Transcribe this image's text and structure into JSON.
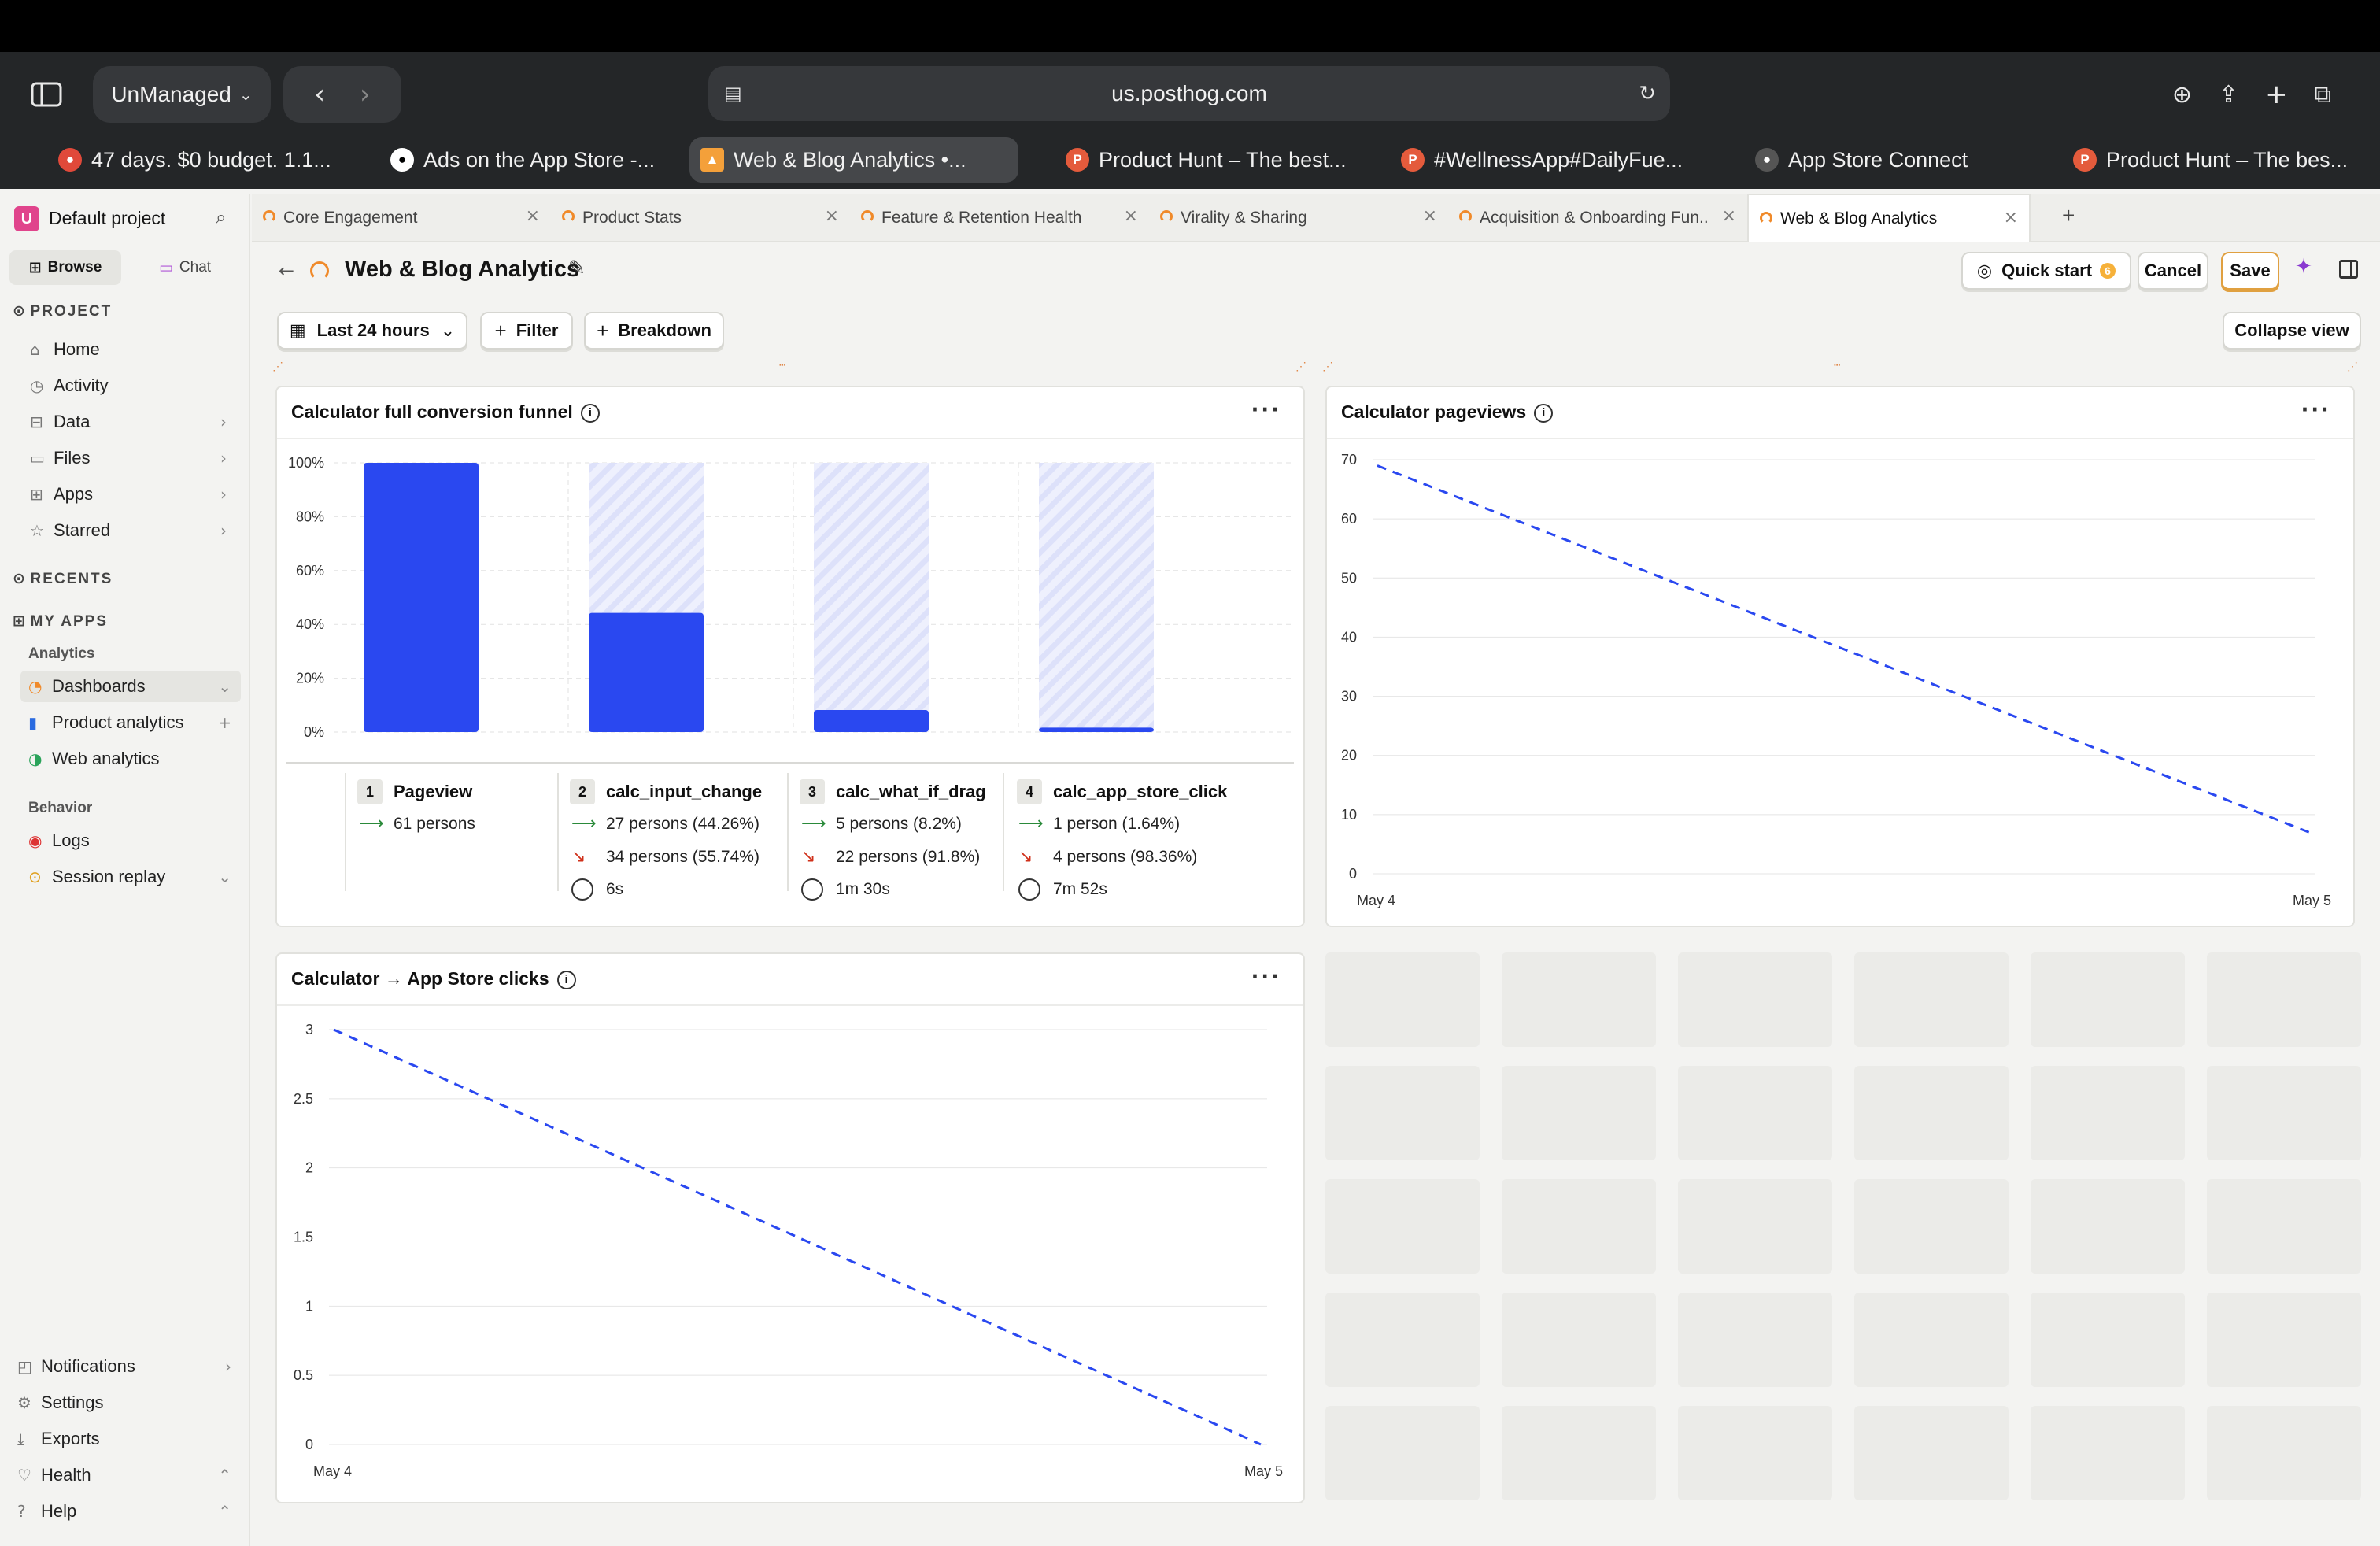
{
  "browser": {
    "profile": "UnManaged",
    "url": "us.posthog.com",
    "tabs": [
      {
        "title": "47 days. $0 budget. 1.1...",
        "color": "#e0493a",
        "icon": "reddit-icon"
      },
      {
        "title": "Ads on the App Store -...",
        "color": "#ffffff",
        "icon": "apple-icon"
      },
      {
        "title": "Web & Blog Analytics •...",
        "color": "#f4a03a",
        "icon": "posthog-icon"
      },
      {
        "title": "Product Hunt – The best...",
        "color": "#e45b3c",
        "icon": "producthunt-icon"
      },
      {
        "title": "#WellnessApp#DailyFue...",
        "color": "#e45b3c",
        "icon": "producthunt-icon"
      },
      {
        "title": "App Store Connect",
        "color": "#555",
        "icon": "apple-icon"
      },
      {
        "title": "Product Hunt – The bes...",
        "color": "#e45b3c",
        "icon": "producthunt-icon"
      }
    ]
  },
  "sidebar": {
    "project_badge": "U",
    "project": "Default project",
    "browse": "Browse",
    "chat": "Chat",
    "project_heading": "PROJECT",
    "nav": [
      {
        "label": "Home",
        "icon": "home-icon"
      },
      {
        "label": "Activity",
        "icon": "clock-icon"
      },
      {
        "label": "Data",
        "icon": "database-icon"
      },
      {
        "label": "Files",
        "icon": "folder-icon"
      },
      {
        "label": "Apps",
        "icon": "apps-icon"
      },
      {
        "label": "Starred",
        "icon": "star-icon"
      }
    ],
    "recents_heading": "RECENTS",
    "myapps_heading": "MY APPS",
    "analytics_heading": "Analytics",
    "analytics": [
      {
        "label": "Dashboards",
        "icon": "dashboard-icon"
      },
      {
        "label": "Product analytics",
        "icon": "bar-chart-icon"
      },
      {
        "label": "Web analytics",
        "icon": "web-icon"
      }
    ],
    "behavior_heading": "Behavior",
    "behavior": [
      {
        "label": "Logs",
        "icon": "logs-icon"
      },
      {
        "label": "Session replay",
        "icon": "replay-icon"
      }
    ],
    "footer": [
      {
        "label": "Notifications",
        "icon": "bell-icon"
      },
      {
        "label": "Settings",
        "icon": "gear-icon"
      },
      {
        "label": "Exports",
        "icon": "download-icon"
      },
      {
        "label": "Health",
        "icon": "health-icon"
      },
      {
        "label": "Help",
        "icon": "help-icon"
      }
    ]
  },
  "page_tabs": [
    {
      "label": "Core Engagement"
    },
    {
      "label": "Product Stats"
    },
    {
      "label": "Feature & Retention Health"
    },
    {
      "label": "Virality & Sharing"
    },
    {
      "label": "Acquisition & Onboarding Fun..."
    },
    {
      "label": "Web & Blog Analytics"
    }
  ],
  "header": {
    "title": "Web & Blog Analytics",
    "quick_start": "Quick start",
    "quick_start_badge": "6",
    "cancel": "Cancel",
    "save": "Save"
  },
  "filters": {
    "date_range": "Last 24 hours",
    "filter": "Filter",
    "breakdown": "Breakdown",
    "collapse": "Collapse view"
  },
  "accent_color": "#2a48f0",
  "tiles": {
    "funnel": {
      "title": "Calculator full conversion funnel"
    },
    "pageviews": {
      "title": "Calculator pageviews"
    },
    "clicks": {
      "title": "Calculator → App Store clicks"
    }
  },
  "funnel_steps": [
    {
      "num": "1",
      "name": "Pageview",
      "converted": "61 persons",
      "dropped": "",
      "time": ""
    },
    {
      "num": "2",
      "name": "calc_input_change",
      "converted": "27 persons (44.26%)",
      "dropped": "34 persons (55.74%)",
      "time": "6s"
    },
    {
      "num": "3",
      "name": "calc_what_if_drag",
      "converted": "5 persons (8.2%)",
      "dropped": "22 persons (91.8%)",
      "time": "1m 30s"
    },
    {
      "num": "4",
      "name": "calc_app_store_click",
      "converted": "1 person (1.64%)",
      "dropped": "4 persons (98.36%)",
      "time": "7m 52s"
    }
  ],
  "chart_data": [
    {
      "type": "bar",
      "title": "Calculator full conversion funnel",
      "categories": [
        "Pageview",
        "calc_input_change",
        "calc_what_if_drag",
        "calc_app_store_click"
      ],
      "values": [
        100,
        44.26,
        8.2,
        1.64
      ],
      "y_ticks": [
        "0%",
        "20%",
        "40%",
        "60%",
        "80%",
        "100%"
      ],
      "ylim": [
        0,
        100
      ],
      "grid": true
    },
    {
      "type": "line",
      "title": "Calculator pageviews",
      "x": [
        "May 4",
        "May 5"
      ],
      "values": [
        69,
        7
      ],
      "y_ticks": [
        "0",
        "10",
        "20",
        "30",
        "40",
        "50",
        "60",
        "70"
      ],
      "ylim": [
        0,
        70
      ],
      "style": "dashed",
      "grid": true
    },
    {
      "type": "line",
      "title": "Calculator → App Store clicks",
      "x": [
        "May 4",
        "May 5"
      ],
      "values": [
        3,
        0
      ],
      "y_ticks": [
        "0",
        "0.5",
        "1",
        "1.5",
        "2",
        "2.5",
        "3"
      ],
      "ylim": [
        0,
        3
      ],
      "style": "dashed",
      "grid": true
    }
  ]
}
